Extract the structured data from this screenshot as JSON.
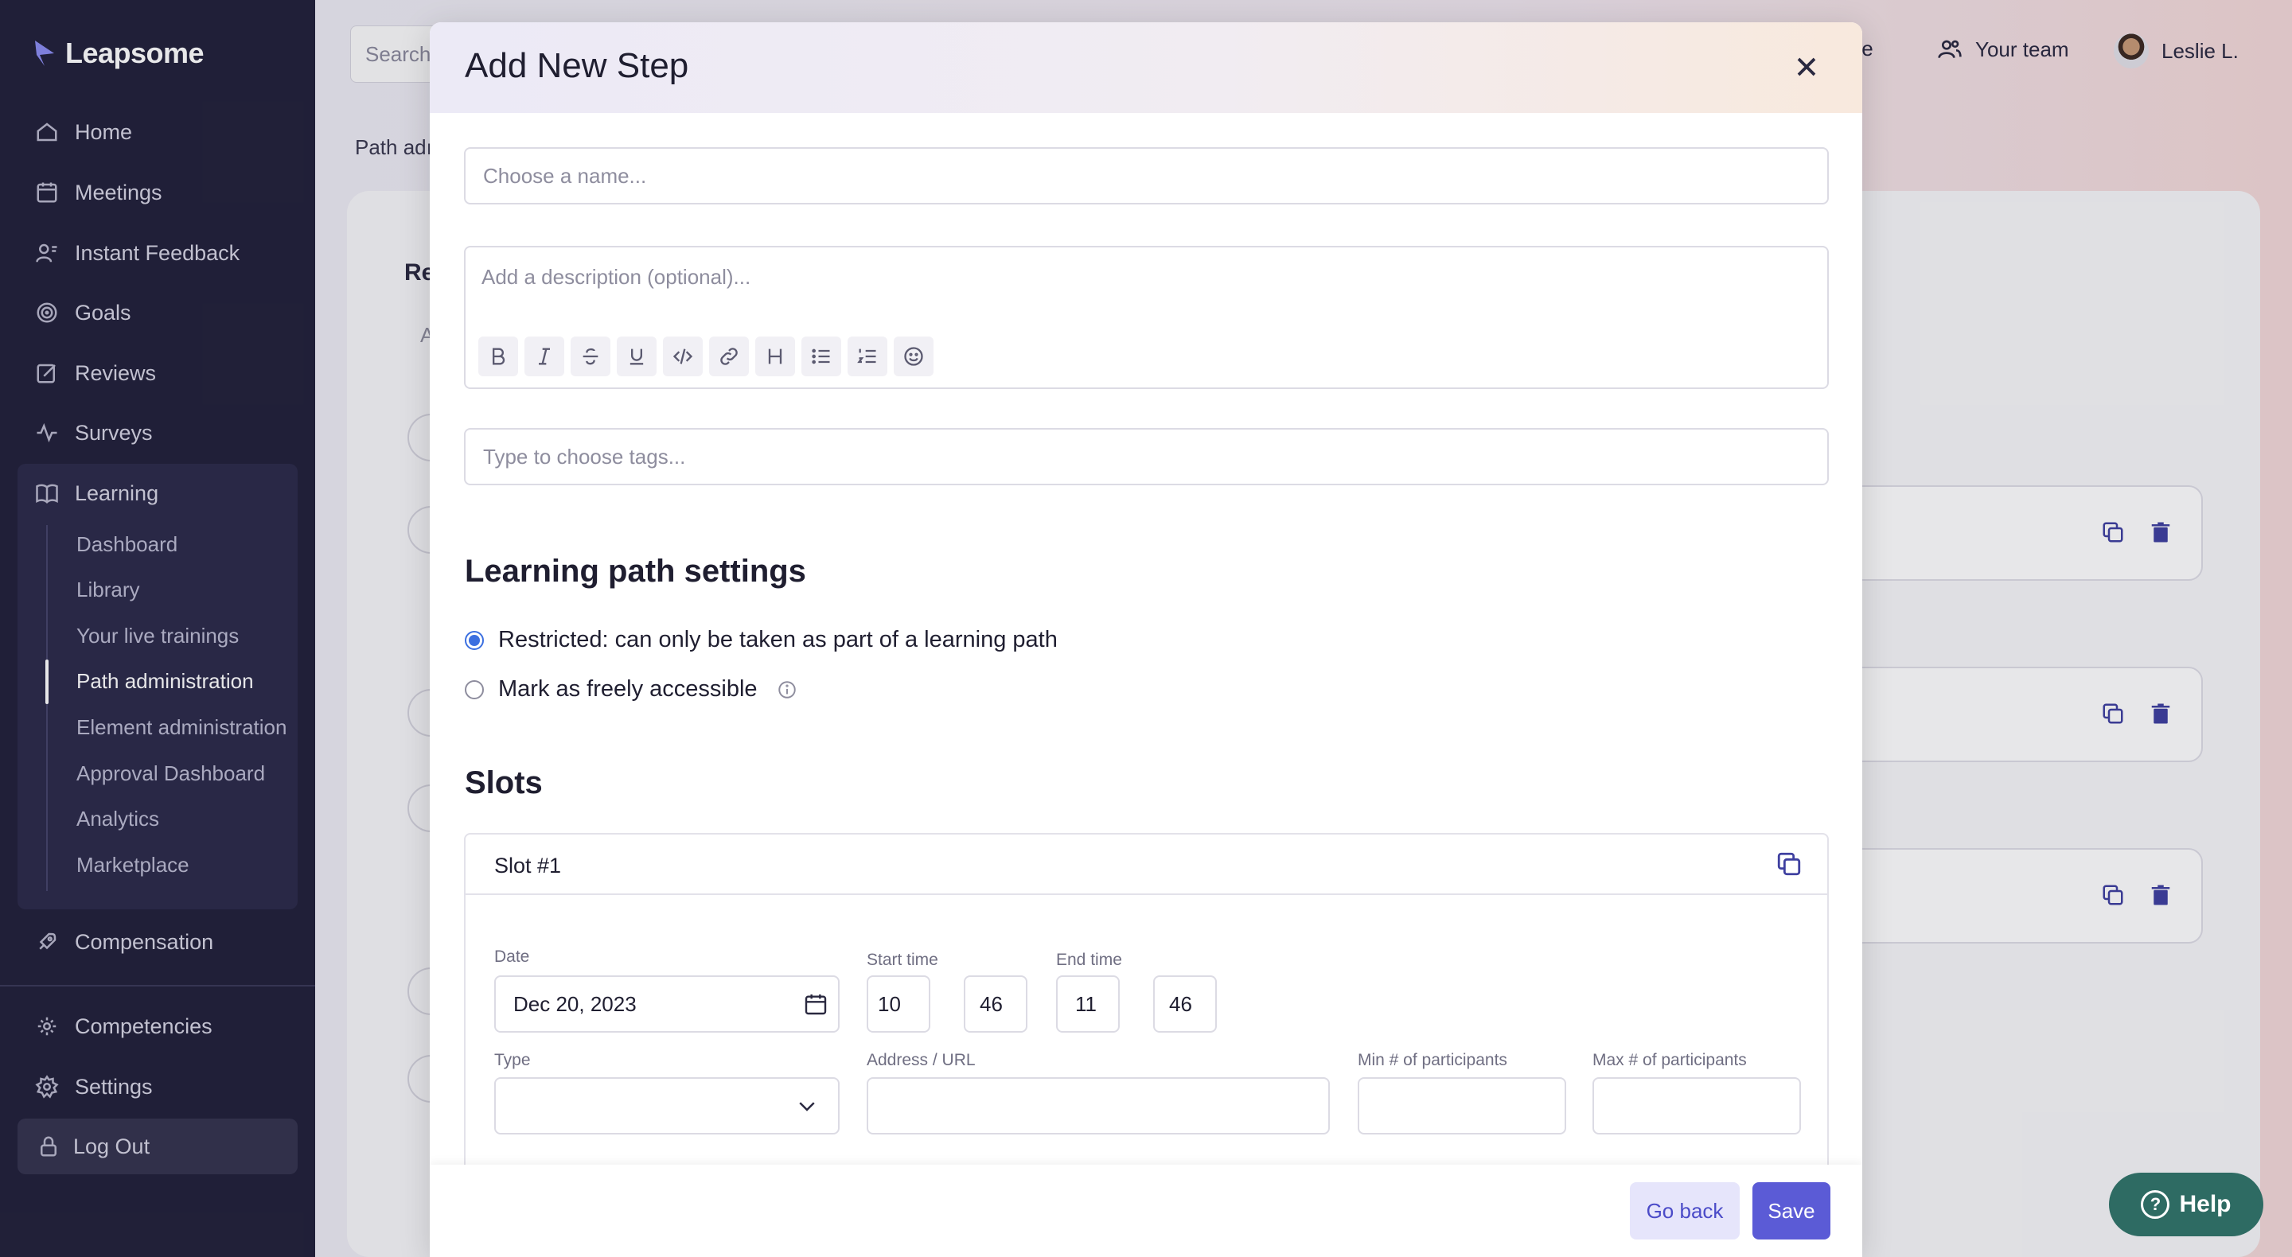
{
  "app": {
    "logo_text": "Leapsome"
  },
  "sidebar": {
    "items": [
      {
        "label": "Home",
        "icon": "home-icon"
      },
      {
        "label": "Meetings",
        "icon": "meetings-icon"
      },
      {
        "label": "Instant Feedback",
        "icon": "feedback-icon"
      },
      {
        "label": "Goals",
        "icon": "goals-icon"
      },
      {
        "label": "Reviews",
        "icon": "reviews-icon"
      },
      {
        "label": "Surveys",
        "icon": "surveys-icon"
      },
      {
        "label": "Learning",
        "icon": "book-icon"
      }
    ],
    "learning_subitems": [
      {
        "label": "Dashboard"
      },
      {
        "label": "Library"
      },
      {
        "label": "Your live trainings"
      },
      {
        "label": "Path administration"
      },
      {
        "label": "Element administration"
      },
      {
        "label": "Approval Dashboard"
      },
      {
        "label": "Analytics"
      },
      {
        "label": "Marketplace"
      }
    ],
    "active_subitem": "Path administration",
    "bottom_items": [
      {
        "label": "Compensation",
        "icon": "rocket-icon"
      },
      {
        "label": "Competencies",
        "icon": "competencies-icon"
      },
      {
        "label": "Settings",
        "icon": "gear-icon"
      }
    ],
    "logout_label": "Log Out"
  },
  "topbar": {
    "search_placeholder": "Search",
    "partial_item": "te",
    "team_label": "Your team",
    "user_label": "Leslie L."
  },
  "background": {
    "breadcrumb": "Path adı",
    "heading_fragment": "Re",
    "subtext_fragment": "A"
  },
  "modal": {
    "title": "Add New Step",
    "name_placeholder": "Choose a name...",
    "description_placeholder": "Add a description (optional)...",
    "toolbar": [
      "bold",
      "italic",
      "strikethrough",
      "underline",
      "code",
      "link",
      "heading",
      "bullet-list",
      "numbered-list",
      "emoji"
    ],
    "tags_placeholder": "Type to choose tags...",
    "learning_path_settings_title": "Learning path settings",
    "options": [
      {
        "label": "Restricted: can only be taken as part of a learning path",
        "checked": true
      },
      {
        "label": "Mark as freely accessible",
        "checked": false
      }
    ],
    "slots_title": "Slots",
    "slot": {
      "title": "Slot #1",
      "date_label": "Date",
      "date_value": "Dec 20, 2023",
      "start_time_label": "Start time",
      "start_hour": "10",
      "start_minute": "46",
      "end_time_label": "End time",
      "end_hour": "11",
      "end_minute": "46",
      "time_separator": ":",
      "type_label": "Type",
      "type_value": "",
      "address_label": "Address / URL",
      "address_value": "",
      "min_label": "Min # of participants",
      "min_value": "",
      "max_label": "Max # of participants",
      "max_value": ""
    },
    "go_back_label": "Go back",
    "save_label": "Save"
  },
  "help": {
    "label": "Help"
  },
  "colors": {
    "sidebar_bg": "#22213a",
    "accent": "#5b5bd6",
    "radio_accent": "#3b6fe0",
    "help_bg": "#2e6b63"
  }
}
